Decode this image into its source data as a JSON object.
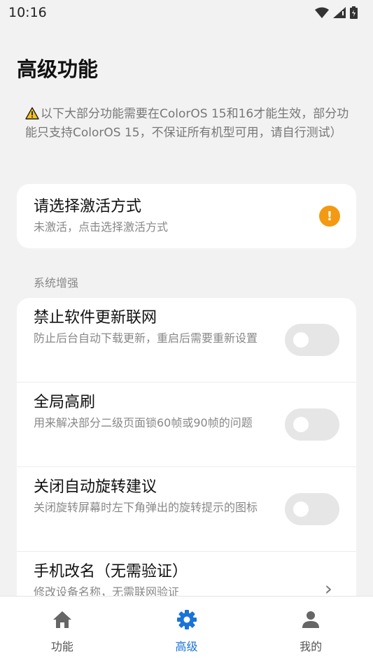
{
  "status_bar": {
    "time": "10:16"
  },
  "page": {
    "title": "高级功能"
  },
  "notice": {
    "text": "以下大部分功能需要在ColorOS 15和16才能生效，部分功能只支持ColorOS 15，不保证所有机型可用，请自行测试）"
  },
  "activation": {
    "title": "请选择激活方式",
    "subtitle": "未激活，点击选择激活方式",
    "alert_symbol": "!"
  },
  "section": {
    "label": "系统增强"
  },
  "settings": [
    {
      "title": "禁止软件更新联网",
      "subtitle": "防止后台自动下载更新，重启后需要重新设置",
      "control": "toggle",
      "enabled": false
    },
    {
      "title": "全局高刷",
      "subtitle": "用来解决部分二级页面锁60帧或90帧的问题",
      "control": "toggle",
      "enabled": false
    },
    {
      "title": "关闭自动旋转建议",
      "subtitle": "关闭旋转屏幕时左下角弹出的旋转提示的图标",
      "control": "toggle",
      "enabled": false
    },
    {
      "title": "手机改名（无需验证）",
      "subtitle": "修改设备名称，无需联网验证",
      "control": "chevron"
    }
  ],
  "bottom_nav": {
    "items": [
      {
        "label": "功能",
        "icon": "home-icon"
      },
      {
        "label": "高级",
        "icon": "gear-icon",
        "active": true
      },
      {
        "label": "我的",
        "icon": "person-icon"
      }
    ]
  },
  "colors": {
    "accent": "#1a73d9",
    "warning": "#f39a12",
    "background": "#f2f2f2"
  }
}
